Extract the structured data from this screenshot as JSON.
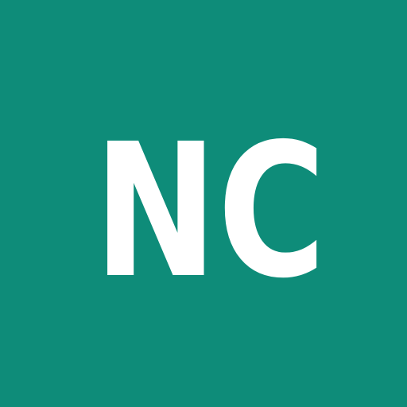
{
  "avatar": {
    "initials": "NC",
    "background_color": "#0e8c79",
    "text_color": "#ffffff"
  }
}
